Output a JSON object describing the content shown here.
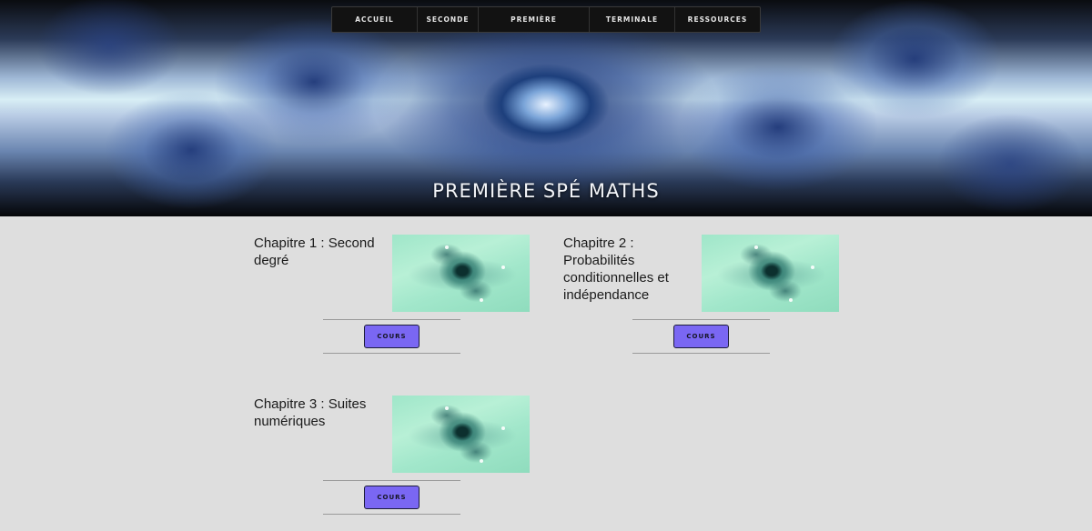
{
  "nav": {
    "items": [
      {
        "label": "ACCUEIL"
      },
      {
        "label": "SECONDE"
      },
      {
        "label": "PREMIÈRE"
      },
      {
        "label": "TERMINALE"
      },
      {
        "label": "RESSOURCES"
      }
    ]
  },
  "hero": {
    "title": "PREMIÈRE SPÉ MATHS"
  },
  "chapters": [
    {
      "title": "Chapitre 1 : Second degré",
      "button_label": "COURS"
    },
    {
      "title": "Chapitre 2 : Probabilités conditionnelles et indépendance",
      "button_label": "COURS"
    },
    {
      "title": "Chapitre 3 : Suites numériques",
      "button_label": "COURS"
    }
  ],
  "colors": {
    "page_background": "#dedede",
    "nav_background": "#121212",
    "button_accent": "#7a67f3"
  },
  "icons": {
    "chapter_image": "fractal-thumbnail"
  }
}
